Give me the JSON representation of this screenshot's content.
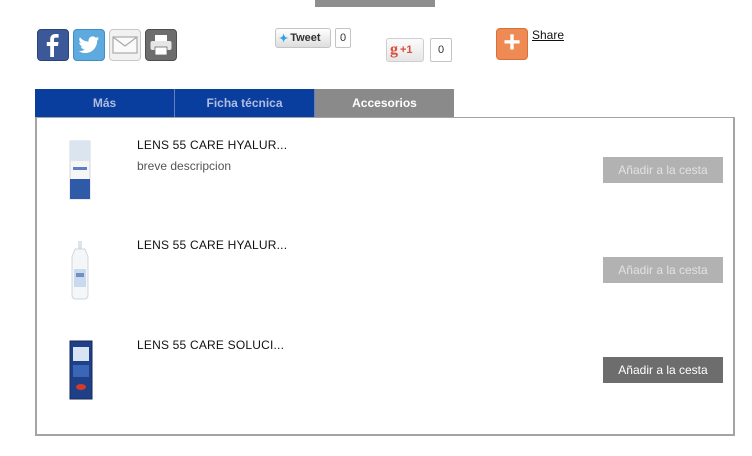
{
  "social": {
    "tweet_label": "Tweet",
    "tweet_count": "0",
    "gplus_label": "+1",
    "gplus_count": "0",
    "share_label": "Share"
  },
  "tabs": [
    {
      "label": "Más"
    },
    {
      "label": "Ficha técnica"
    },
    {
      "label": "Accesorios"
    }
  ],
  "products": [
    {
      "title": "LENS 55 CARE HYALUR...",
      "description": "breve descripcion",
      "add_label": "Añadir a la cesta",
      "enabled": false
    },
    {
      "title": "LENS 55 CARE HYALUR...",
      "description": "",
      "add_label": "Añadir a la cesta",
      "enabled": false
    },
    {
      "title": "LENS 55 CARE SOLUCI...",
      "description": "",
      "add_label": "Añadir a la cesta",
      "enabled": true
    }
  ],
  "colors": {
    "tab_inactive": "#0a3e9e",
    "tab_active": "#8a8a8a",
    "button_disabled": "#b2b2b2",
    "button_enabled": "#6d6d6d"
  }
}
